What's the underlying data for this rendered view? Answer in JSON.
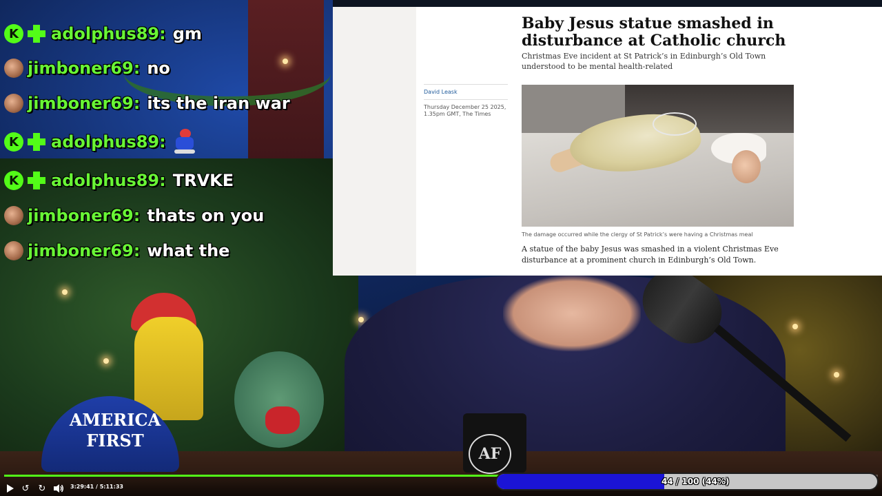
{
  "chat": {
    "messages": [
      {
        "user": "adolphus89:",
        "text": "gm",
        "badges": [
          "kick-icon",
          "plus-icon"
        ],
        "emote": null
      },
      {
        "user": "jimboner69:",
        "text": "no",
        "badges": [
          "avatar-icon"
        ],
        "emote": null
      },
      {
        "user": "jimboner69:",
        "text": "its the iran war",
        "badges": [
          "avatar-icon"
        ],
        "emote": null
      },
      {
        "user": "adolphus89:",
        "text": "",
        "badges": [
          "kick-icon",
          "plus-icon"
        ],
        "emote": "running-mario-emote"
      },
      {
        "user": "adolphus89:",
        "text": "TRVKE",
        "badges": [
          "kick-icon",
          "plus-icon"
        ],
        "emote": null
      },
      {
        "user": "jimboner69:",
        "text": "thats on you",
        "badges": [
          "avatar-icon"
        ],
        "emote": null
      },
      {
        "user": "jimboner69:",
        "text": "what the",
        "badges": [
          "avatar-icon"
        ],
        "emote": null
      }
    ],
    "kick_badge_letter": "K"
  },
  "article": {
    "headline": "Baby Jesus statue smashed in disturbance at Catholic church",
    "standfirst": "Christmas Eve incident at St Patrick’s in Edinburgh’s Old Town understood to be mental health-related",
    "author": "David Leask",
    "dateline": "Thursday December 25 2025, 1.35pm GMT, The Times",
    "caption": "The damage occurred while the clergy of St Patrick’s were having a Christmas meal",
    "body": "A statue of the baby Jesus was smashed in a violent Christmas Eve disturbance at a prominent church in Edinburgh’s Old Town."
  },
  "scene": {
    "hat_text": "AMERICA FIRST",
    "mug_logo": "AF"
  },
  "player": {
    "time": "3:29:41 / 5:11:33",
    "progress_fraction": 0.673,
    "goal_label": "44 / 100 (44%)",
    "goal_fraction": 0.44
  },
  "colors": {
    "chat_username": "#68f535",
    "kick_green": "#53fc18",
    "goal_fill": "#1b14d6",
    "goal_track": "#c7c7c7"
  }
}
